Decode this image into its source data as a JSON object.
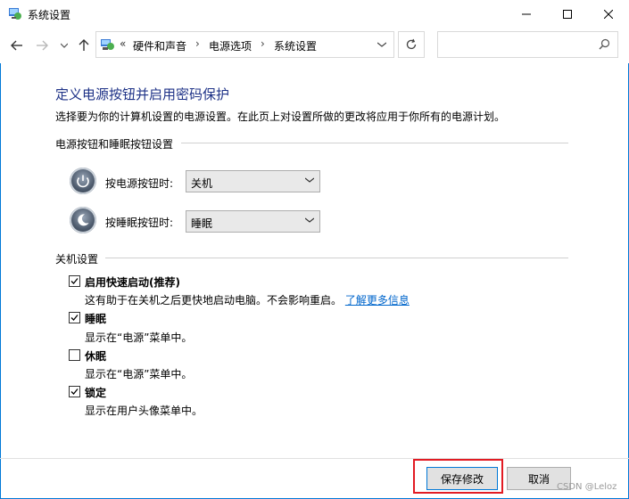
{
  "window": {
    "title": "系统设置",
    "controls": [
      "minimize",
      "maximize",
      "close"
    ]
  },
  "navbar": {
    "breadcrumb_prefix": "«",
    "breadcrumbs": [
      "硬件和声音",
      "电源选项",
      "系统设置"
    ],
    "search_placeholder": ""
  },
  "page": {
    "title": "定义电源按钮并启用密码保护",
    "description": "选择要为你的计算机设置的电源设置。在此页上对设置所做的更改将应用于你所有的电源计划。"
  },
  "power_section": {
    "label": "电源按钮和睡眠按钮设置",
    "rows": [
      {
        "label": "按电源按钮时:",
        "value": "关机",
        "icon": "power-button-icon"
      },
      {
        "label": "按睡眠按钮时:",
        "value": "睡眠",
        "icon": "sleep-button-icon"
      }
    ]
  },
  "shutdown_section": {
    "label": "关机设置",
    "items": [
      {
        "label": "启用快速启动(推荐)",
        "checked": true,
        "desc": "这有助于在关机之后更快地启动电脑。不会影响重启。",
        "link": "了解更多信息"
      },
      {
        "label": "睡眠",
        "checked": true,
        "desc": "显示在“电源”菜单中。"
      },
      {
        "label": "休眠",
        "checked": false,
        "desc": "显示在“电源”菜单中。"
      },
      {
        "label": "锁定",
        "checked": true,
        "desc": "显示在用户头像菜单中。"
      }
    ]
  },
  "buttons": {
    "save": "保存修改",
    "cancel": "取消"
  },
  "watermark": "CSDN @Leloz",
  "colors": {
    "accent": "#0078d7",
    "title": "#1e3287",
    "link": "#0066cc",
    "highlight": "#e21b23"
  }
}
